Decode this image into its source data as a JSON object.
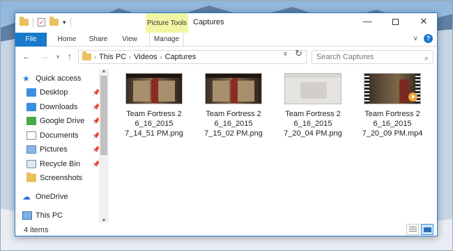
{
  "window": {
    "title": "Captures",
    "contextual_tab": "Picture Tools",
    "controls": {
      "minimize": "—",
      "close": "✕"
    }
  },
  "ribbon": {
    "tabs": [
      "File",
      "Home",
      "Share",
      "View",
      "Manage"
    ]
  },
  "address": {
    "breadcrumbs": [
      "This PC",
      "Videos",
      "Captures"
    ],
    "search_placeholder": "Search Captures"
  },
  "nav_pane": {
    "items": [
      {
        "label": "Quick access",
        "icon": "star-icon",
        "pinned": false
      },
      {
        "label": "Desktop",
        "icon": "desktop-folder-icon",
        "pinned": true
      },
      {
        "label": "Downloads",
        "icon": "downloads-folder-icon",
        "pinned": true
      },
      {
        "label": "Google Drive",
        "icon": "google-drive-folder-icon",
        "pinned": true
      },
      {
        "label": "Documents",
        "icon": "documents-folder-icon",
        "pinned": true
      },
      {
        "label": "Pictures",
        "icon": "pictures-folder-icon",
        "pinned": true
      },
      {
        "label": "Recycle Bin",
        "icon": "recycle-bin-icon",
        "pinned": true
      },
      {
        "label": "Screenshots",
        "icon": "folder-icon",
        "pinned": false
      },
      {
        "label": "OneDrive",
        "icon": "onedrive-icon",
        "pinned": false
      },
      {
        "label": "This PC",
        "icon": "this-pc-icon",
        "pinned": false
      }
    ]
  },
  "files": [
    {
      "name_lines": [
        "Team Fortress 2",
        "6_16_2015",
        "7_14_51 PM.png"
      ],
      "kind": "image"
    },
    {
      "name_lines": [
        "Team Fortress 2",
        "6_16_2015",
        "7_15_02 PM.png"
      ],
      "kind": "image"
    },
    {
      "name_lines": [
        "Team Fortress 2",
        "6_16_2015",
        "7_20_04 PM.png"
      ],
      "kind": "image-blank"
    },
    {
      "name_lines": [
        "Team Fortress 2",
        "6_16_2015",
        "7_20_09 PM.mp4"
      ],
      "kind": "video"
    }
  ],
  "status": {
    "count": "4 items"
  },
  "colors": {
    "accent": "#1979ca",
    "contextual": "#f2f6a4",
    "folder": "#e8c15a"
  }
}
